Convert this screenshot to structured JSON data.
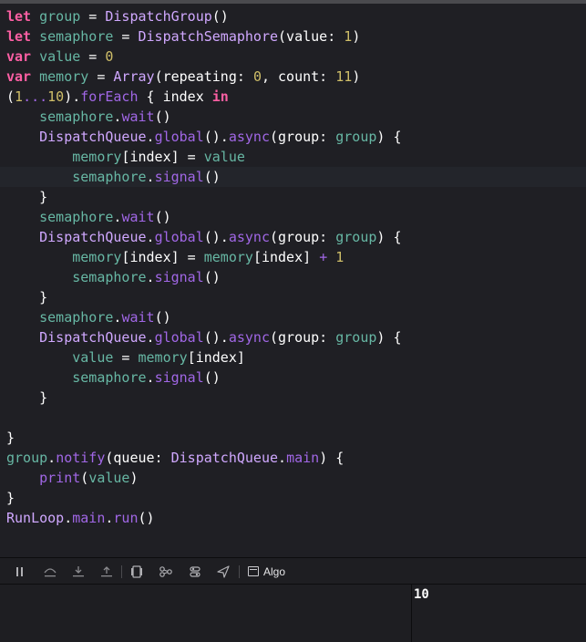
{
  "editor": {
    "lines": [
      [
        {
          "t": "let",
          "c": "kw"
        },
        {
          "t": " ",
          "c": "pl"
        },
        {
          "t": "group",
          "c": "var"
        },
        {
          "t": " = ",
          "c": "pl"
        },
        {
          "t": "DispatchGroup",
          "c": "type"
        },
        {
          "t": "()",
          "c": "pl"
        }
      ],
      [
        {
          "t": "let",
          "c": "kw"
        },
        {
          "t": " ",
          "c": "pl"
        },
        {
          "t": "semaphore",
          "c": "var"
        },
        {
          "t": " = ",
          "c": "pl"
        },
        {
          "t": "DispatchSemaphore",
          "c": "type"
        },
        {
          "t": "(value: ",
          "c": "pl"
        },
        {
          "t": "1",
          "c": "num"
        },
        {
          "t": ")",
          "c": "pl"
        }
      ],
      [
        {
          "t": "var",
          "c": "kw"
        },
        {
          "t": " ",
          "c": "pl"
        },
        {
          "t": "value",
          "c": "var"
        },
        {
          "t": " = ",
          "c": "pl"
        },
        {
          "t": "0",
          "c": "num"
        }
      ],
      [
        {
          "t": "var",
          "c": "kw"
        },
        {
          "t": " ",
          "c": "pl"
        },
        {
          "t": "memory",
          "c": "var"
        },
        {
          "t": " = ",
          "c": "pl"
        },
        {
          "t": "Array",
          "c": "type"
        },
        {
          "t": "(repeating: ",
          "c": "pl"
        },
        {
          "t": "0",
          "c": "num"
        },
        {
          "t": ", count: ",
          "c": "pl"
        },
        {
          "t": "11",
          "c": "num"
        },
        {
          "t": ")",
          "c": "pl"
        }
      ],
      [
        {
          "t": "(",
          "c": "pl"
        },
        {
          "t": "1",
          "c": "num"
        },
        {
          "t": "...",
          "c": "fn"
        },
        {
          "t": "10",
          "c": "num"
        },
        {
          "t": ").",
          "c": "pl"
        },
        {
          "t": "forEach",
          "c": "fn"
        },
        {
          "t": " { index ",
          "c": "pl"
        },
        {
          "t": "in",
          "c": "kw"
        }
      ],
      [
        {
          "t": "    ",
          "c": "pl"
        },
        {
          "t": "semaphore",
          "c": "var"
        },
        {
          "t": ".",
          "c": "pl"
        },
        {
          "t": "wait",
          "c": "fn"
        },
        {
          "t": "()",
          "c": "pl"
        }
      ],
      [
        {
          "t": "    ",
          "c": "pl"
        },
        {
          "t": "DispatchQueue",
          "c": "type"
        },
        {
          "t": ".",
          "c": "pl"
        },
        {
          "t": "global",
          "c": "fn"
        },
        {
          "t": "().",
          "c": "pl"
        },
        {
          "t": "async",
          "c": "fn"
        },
        {
          "t": "(group: ",
          "c": "pl"
        },
        {
          "t": "group",
          "c": "var"
        },
        {
          "t": ") {",
          "c": "pl"
        }
      ],
      [
        {
          "t": "        ",
          "c": "pl"
        },
        {
          "t": "memory",
          "c": "var"
        },
        {
          "t": "[index] = ",
          "c": "pl"
        },
        {
          "t": "value",
          "c": "var"
        }
      ],
      [
        {
          "t": "        ",
          "c": "pl"
        },
        {
          "t": "semaphore",
          "c": "var"
        },
        {
          "t": ".",
          "c": "pl"
        },
        {
          "t": "signal",
          "c": "fn"
        },
        {
          "t": "()",
          "c": "pl"
        }
      ],
      [
        {
          "t": "    }",
          "c": "pl"
        }
      ],
      [
        {
          "t": "    ",
          "c": "pl"
        },
        {
          "t": "semaphore",
          "c": "var"
        },
        {
          "t": ".",
          "c": "pl"
        },
        {
          "t": "wait",
          "c": "fn"
        },
        {
          "t": "()",
          "c": "pl"
        }
      ],
      [
        {
          "t": "    ",
          "c": "pl"
        },
        {
          "t": "DispatchQueue",
          "c": "type"
        },
        {
          "t": ".",
          "c": "pl"
        },
        {
          "t": "global",
          "c": "fn"
        },
        {
          "t": "().",
          "c": "pl"
        },
        {
          "t": "async",
          "c": "fn"
        },
        {
          "t": "(group: ",
          "c": "pl"
        },
        {
          "t": "group",
          "c": "var"
        },
        {
          "t": ") {",
          "c": "pl"
        }
      ],
      [
        {
          "t": "        ",
          "c": "pl"
        },
        {
          "t": "memory",
          "c": "var"
        },
        {
          "t": "[index] = ",
          "c": "pl"
        },
        {
          "t": "memory",
          "c": "var"
        },
        {
          "t": "[index] ",
          "c": "pl"
        },
        {
          "t": "+",
          "c": "fn"
        },
        {
          "t": " ",
          "c": "pl"
        },
        {
          "t": "1",
          "c": "num"
        }
      ],
      [
        {
          "t": "        ",
          "c": "pl"
        },
        {
          "t": "semaphore",
          "c": "var"
        },
        {
          "t": ".",
          "c": "pl"
        },
        {
          "t": "signal",
          "c": "fn"
        },
        {
          "t": "()",
          "c": "pl"
        }
      ],
      [
        {
          "t": "    }",
          "c": "pl"
        }
      ],
      [
        {
          "t": "    ",
          "c": "pl"
        },
        {
          "t": "semaphore",
          "c": "var"
        },
        {
          "t": ".",
          "c": "pl"
        },
        {
          "t": "wait",
          "c": "fn"
        },
        {
          "t": "()",
          "c": "pl"
        }
      ],
      [
        {
          "t": "    ",
          "c": "pl"
        },
        {
          "t": "DispatchQueue",
          "c": "type"
        },
        {
          "t": ".",
          "c": "pl"
        },
        {
          "t": "global",
          "c": "fn"
        },
        {
          "t": "().",
          "c": "pl"
        },
        {
          "t": "async",
          "c": "fn"
        },
        {
          "t": "(group: ",
          "c": "pl"
        },
        {
          "t": "group",
          "c": "var"
        },
        {
          "t": ") {",
          "c": "pl"
        }
      ],
      [
        {
          "t": "        ",
          "c": "pl"
        },
        {
          "t": "value",
          "c": "var"
        },
        {
          "t": " = ",
          "c": "pl"
        },
        {
          "t": "memory",
          "c": "var"
        },
        {
          "t": "[index]",
          "c": "pl"
        }
      ],
      [
        {
          "t": "        ",
          "c": "pl"
        },
        {
          "t": "semaphore",
          "c": "var"
        },
        {
          "t": ".",
          "c": "pl"
        },
        {
          "t": "signal",
          "c": "fn"
        },
        {
          "t": "()",
          "c": "pl"
        }
      ],
      [
        {
          "t": "    }",
          "c": "pl"
        }
      ],
      [],
      [
        {
          "t": "}",
          "c": "pl"
        }
      ],
      [
        {
          "t": "group",
          "c": "var"
        },
        {
          "t": ".",
          "c": "pl"
        },
        {
          "t": "notify",
          "c": "fn"
        },
        {
          "t": "(queue: ",
          "c": "pl"
        },
        {
          "t": "DispatchQueue",
          "c": "type"
        },
        {
          "t": ".",
          "c": "pl"
        },
        {
          "t": "main",
          "c": "fn"
        },
        {
          "t": ") {",
          "c": "pl"
        }
      ],
      [
        {
          "t": "    ",
          "c": "pl"
        },
        {
          "t": "print",
          "c": "fn"
        },
        {
          "t": "(",
          "c": "pl"
        },
        {
          "t": "value",
          "c": "var"
        },
        {
          "t": ")",
          "c": "pl"
        }
      ],
      [
        {
          "t": "}",
          "c": "pl"
        }
      ],
      [
        {
          "t": "RunLoop",
          "c": "type"
        },
        {
          "t": ".",
          "c": "pl"
        },
        {
          "t": "main",
          "c": "fn"
        },
        {
          "t": ".",
          "c": "pl"
        },
        {
          "t": "run",
          "c": "fn"
        },
        {
          "t": "()",
          "c": "pl"
        }
      ]
    ]
  },
  "debug_bar": {
    "target_label": "Algo",
    "icons": [
      "hide-debug-area-icon",
      "step-over-icon",
      "step-into-icon",
      "step-out-icon",
      "view-hierarchy-icon",
      "memory-graph-icon",
      "environment-overrides-icon",
      "simulate-location-icon",
      "console-target-icon"
    ]
  },
  "console": {
    "output": "10"
  },
  "colors": {
    "keyword": "#fc5fa3",
    "variable": "#67b7a4",
    "type": "#d0a8ff",
    "number": "#d0bf69",
    "function": "#a167e6",
    "plain": "#ffffff",
    "background": "#1f1f24"
  }
}
